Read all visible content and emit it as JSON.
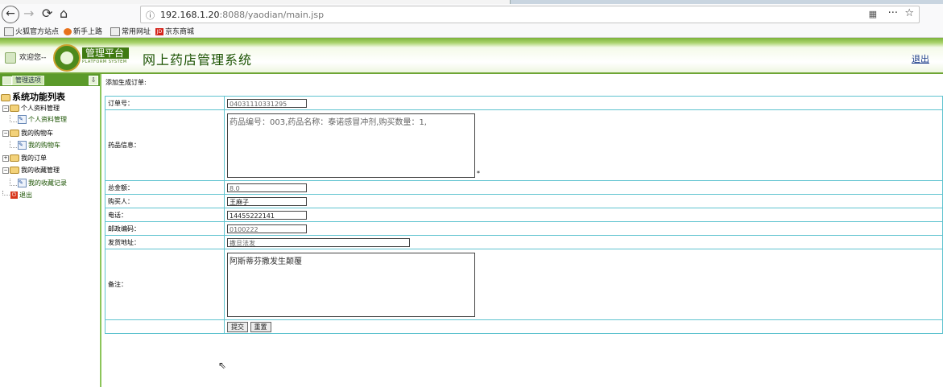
{
  "browser": {
    "url_host": "192.168.1.20",
    "url_rest": ":8088/yaodian/main.jsp",
    "bookmarks": [
      "火狐官方站点",
      "新手上路",
      "常用网址",
      "京东商城"
    ]
  },
  "header": {
    "welcome": "欢迎您--",
    "logo_text": "管理平台",
    "logo_sub": "PLATFORM SYSTEM",
    "title": "网上药店管理系统",
    "logout": "退出"
  },
  "sidebar": {
    "head_label": "管理选项",
    "root": "系统功能列表",
    "items": [
      {
        "label": "个人资料管理",
        "child": "个人资料管理"
      },
      {
        "label": "我的购物车",
        "child": "我的购物车"
      },
      {
        "label": "我的订单",
        "child": ""
      },
      {
        "label": "我的收藏管理",
        "child": "我的收藏记录"
      }
    ],
    "exit": "退出"
  },
  "main": {
    "title": "添加生成订单:",
    "fields": {
      "order_no": {
        "label": "订单号：",
        "value": "04031110331295"
      },
      "drug_info": {
        "label": "药品信息：",
        "value": "药品编号：003,药品名称：泰诺感冒冲剂,购买数量：1,",
        "mark": "*"
      },
      "total": {
        "label": "总金额：",
        "value": "8.0"
      },
      "buyer": {
        "label": "购买人：",
        "value": "王麻子"
      },
      "phone": {
        "label": "电话：",
        "value": "14455222141"
      },
      "zip": {
        "label": "邮政编码：",
        "value": "0100222"
      },
      "address": {
        "label": "发货地址：",
        "value": "撒旦法发"
      },
      "remark": {
        "label": "备注：",
        "value": "阿斯蒂芬撒发生颠覆"
      }
    },
    "submit": "提交",
    "reset": "重置"
  }
}
